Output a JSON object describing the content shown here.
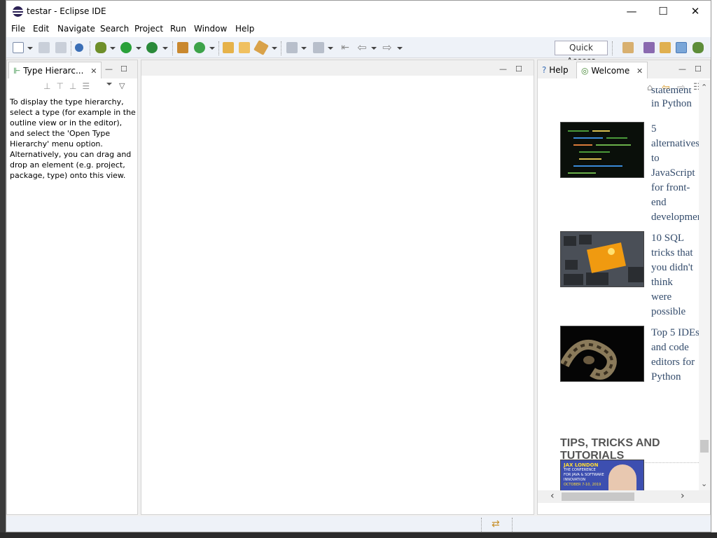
{
  "window": {
    "title": "testar - Eclipse IDE",
    "minimize_symbol": "—",
    "maximize_symbol": "☐",
    "close_symbol": "✕"
  },
  "menubar": {
    "items": [
      "File",
      "Edit",
      "Navigate",
      "Search",
      "Project",
      "Run",
      "Window",
      "Help"
    ]
  },
  "toolbar": {
    "quick_access_placeholder": "Quick Access"
  },
  "type_hierarchy": {
    "tab_label": "Type Hierarc...",
    "message": "To display the type hierarchy, select a type (for example in the outline view or in the editor), and select the 'Open Type Hierarchy' menu option. Alternatively, you can drag and drop an element (e.g. project, package, type) onto this view."
  },
  "welcome_panel": {
    "tabs": [
      {
        "label": "Help",
        "active": false
      },
      {
        "label": "Welcome",
        "active": true
      }
    ],
    "partial_article_lines": [
      "statement",
      "in Python"
    ],
    "articles": [
      {
        "title_lines": [
          "5",
          "alternatives",
          "to",
          "JavaScript",
          "for front-",
          "end",
          "developmen"
        ],
        "image": "code-screen"
      },
      {
        "title_lines": [
          "10 SQL",
          "tricks that",
          "you didn't",
          "think",
          "were",
          "possible"
        ],
        "image": "keyboard-tips"
      },
      {
        "title_lines": [
          "Top 5 IDEs",
          "and code",
          "editors for",
          "Python"
        ],
        "image": "python-snake"
      }
    ],
    "section_heading": "TIPS, TRICKS AND TUTORIALS",
    "jax_banner": {
      "logo": "JAX LONDON",
      "lines": [
        "THE CONFERENCE",
        "FOR JAVA & SOFTWARE",
        "INNOVATION"
      ],
      "date": "OCTOBER 7-10, 2019"
    }
  }
}
